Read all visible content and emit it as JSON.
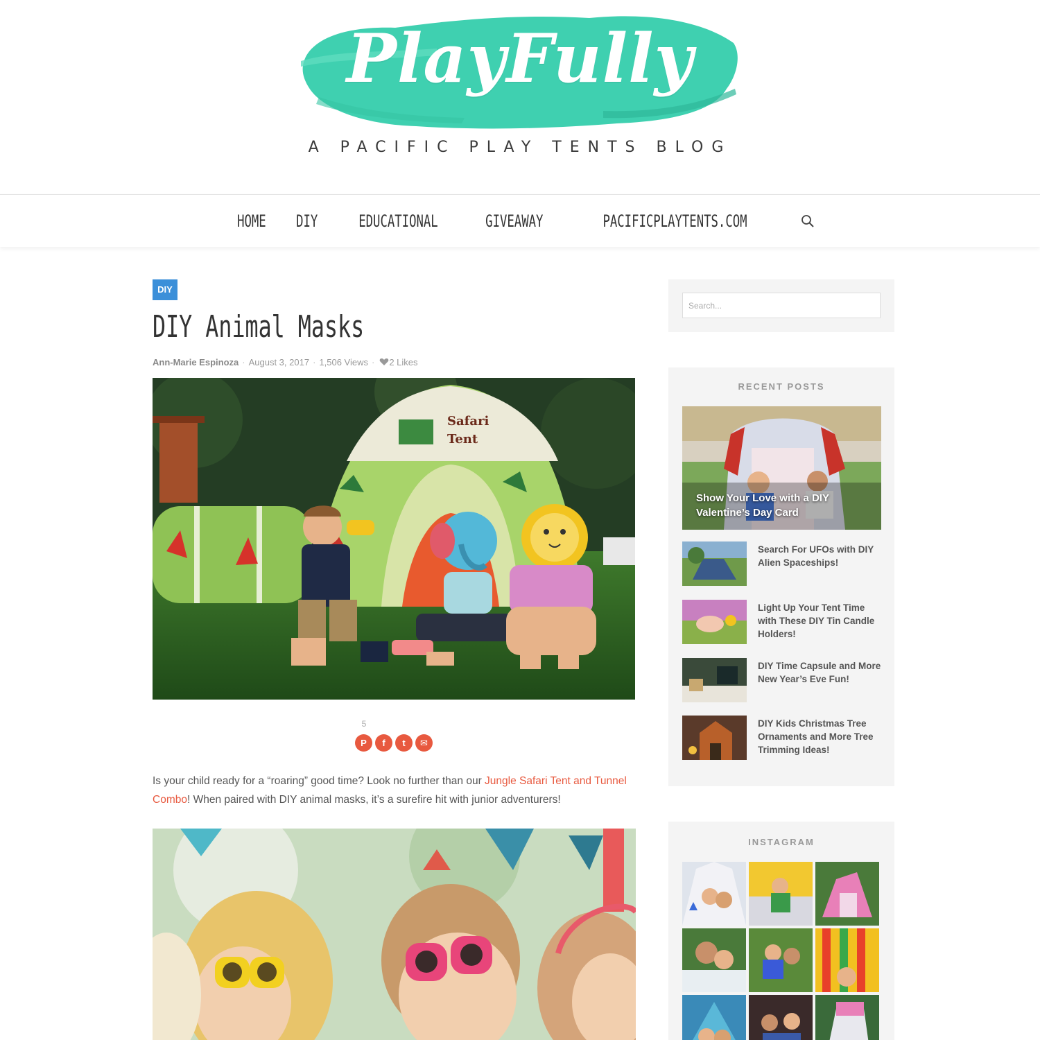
{
  "header": {
    "logo_text": "PlayFully",
    "tagline": "A PACIFIC PLAY TENTS BLOG",
    "logo_color": "#3fd0b0"
  },
  "nav": {
    "items": [
      "HOME",
      "DIY",
      "EDUCATIONAL",
      "GIVEAWAY",
      "PACIFICPLAYTENTS.COM"
    ],
    "search_icon": "search-icon"
  },
  "post": {
    "category": "DIY",
    "category_color": "#3b8fd9",
    "title": "DIY Animal Masks",
    "author": "Ann-Marie Espinoza",
    "date": "August 3, 2017",
    "views": "1,506 Views",
    "likes": "2 Likes",
    "hero_tent_text": [
      "Safari",
      "Tent"
    ],
    "share_count": "5",
    "share_buttons": [
      {
        "name": "pinterest",
        "glyph": "P"
      },
      {
        "name": "facebook",
        "glyph": "f"
      },
      {
        "name": "twitter",
        "glyph": "t"
      },
      {
        "name": "email",
        "glyph": "✉"
      }
    ],
    "accent_color": "#e8593f",
    "intro_before": "Is your child ready for a “roaring” good time? Look no further than our ",
    "intro_link": "Jungle Safari Tent and Tunnel Combo",
    "intro_after": "! When paired with DIY animal masks, it’s a surefire hit with junior adventurers!"
  },
  "sidebar": {
    "search_placeholder": "Search...",
    "recent_title": "RECENT POSTS",
    "recent_feature": "Show Your Love with a DIY Valentine’s Day Card",
    "recent_posts": [
      "Search For UFOs with DIY Alien Spaceships!",
      "Light Up Your Tent Time with These DIY Tin Candle Holders!",
      "DIY Time Capsule and More New Year’s Eve Fun!",
      "DIY Kids Christmas Tree Ornaments and More Tree Trimming Ideas!"
    ],
    "instagram_title": "INSTAGRAM"
  }
}
